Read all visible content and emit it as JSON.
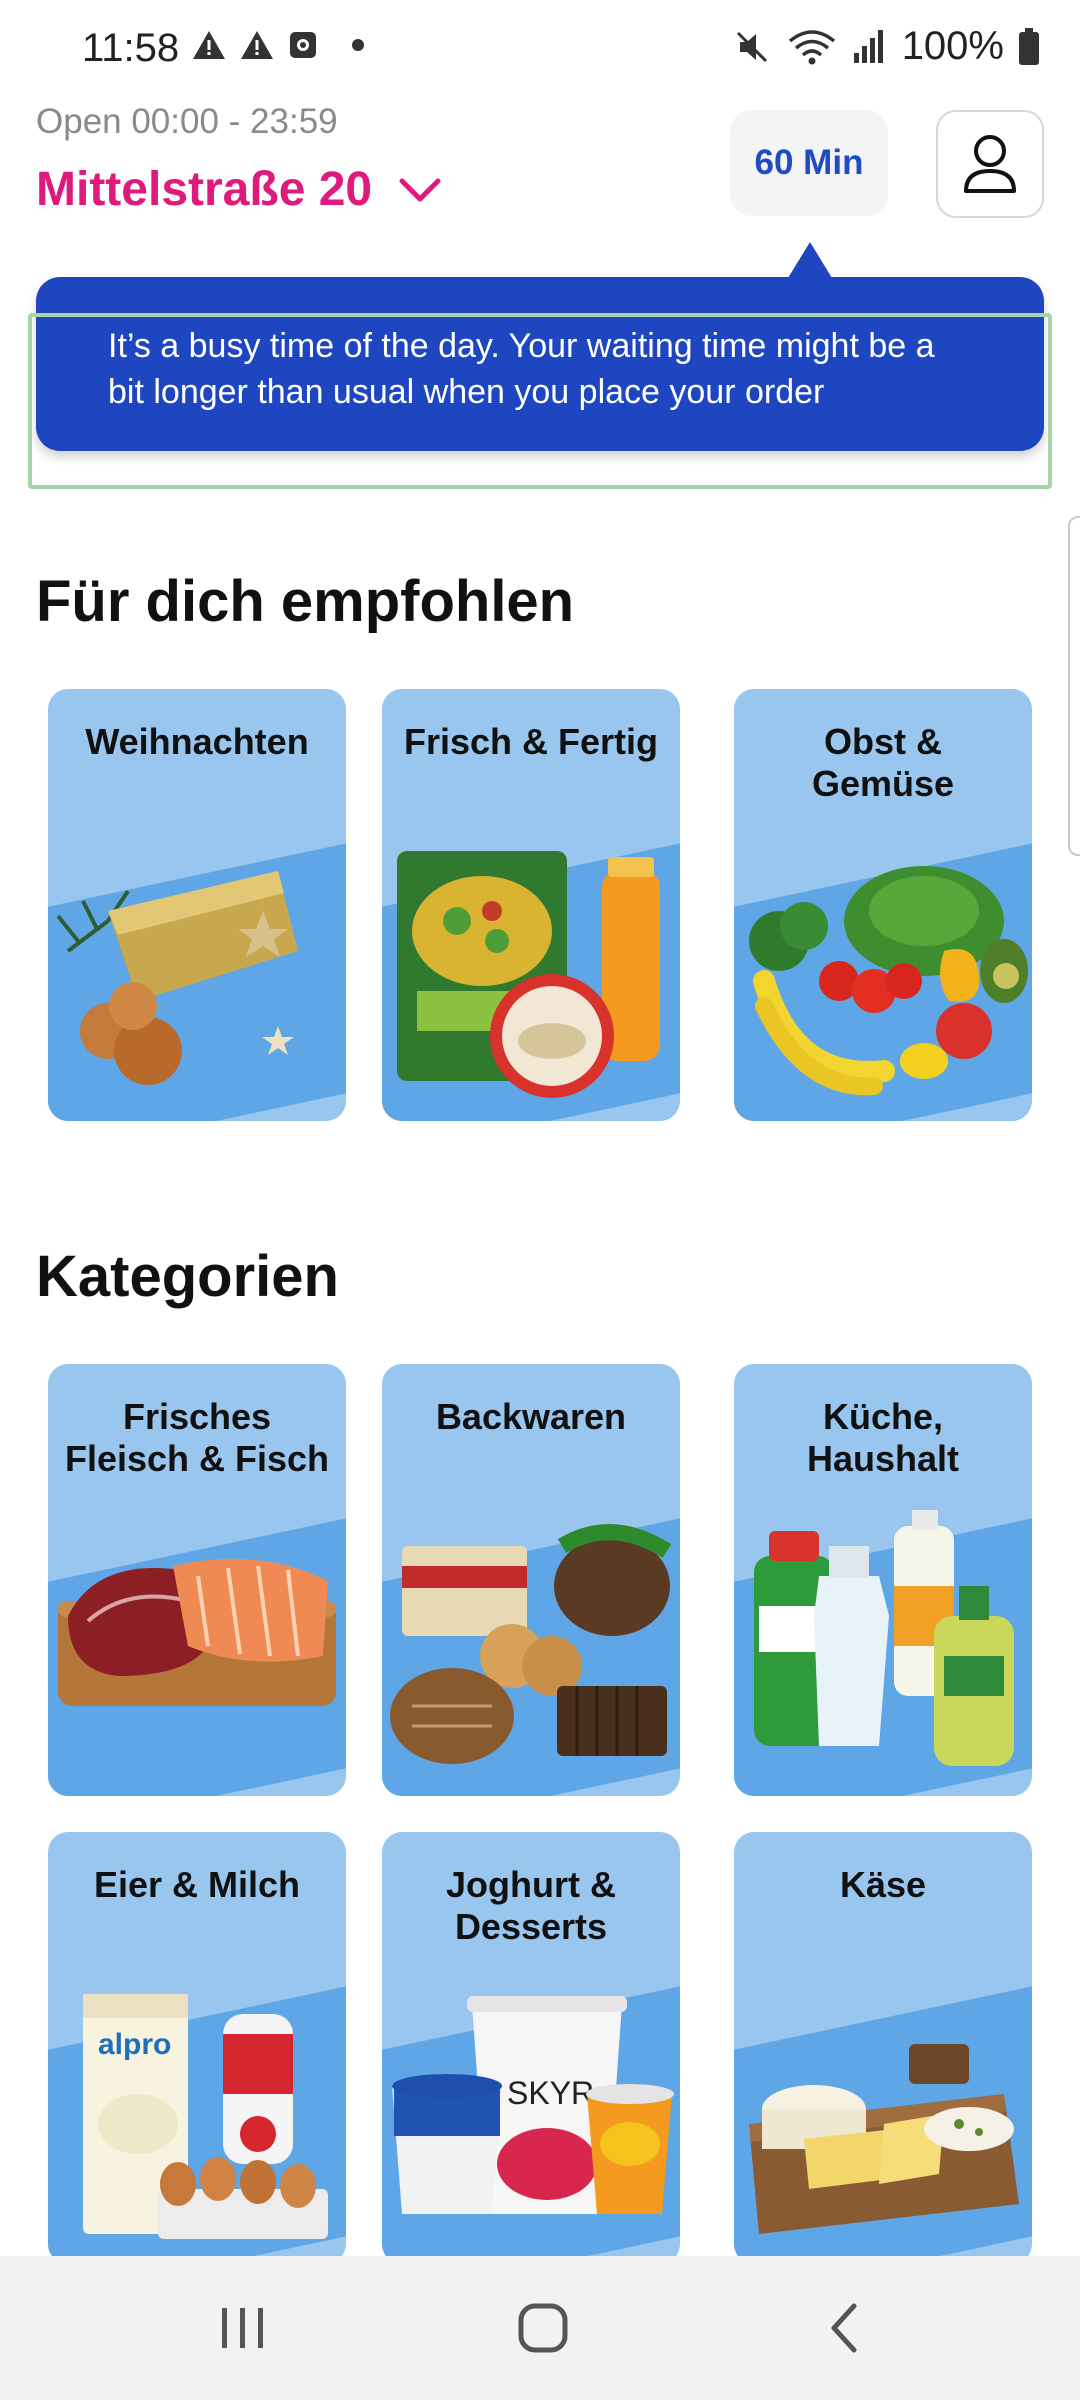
{
  "status_bar": {
    "time": "11:58",
    "battery": "100%",
    "icons": [
      "warning-icon",
      "warning-icon",
      "screen-record-icon",
      "notification-dot-icon",
      "mute-icon",
      "wifi-icon",
      "signal-icon",
      "battery-icon"
    ]
  },
  "header": {
    "open_hours": "Open 00:00 - 23:59",
    "address": "Mittelstraße 20",
    "eta": "60 Min"
  },
  "tooltip": {
    "message": "It’s a busy time of the day. Your waiting time might be a bit longer than usual when you place your order"
  },
  "recommended": {
    "title": "Für dich empfohlen",
    "cards": [
      {
        "label": "Weihnachten",
        "icon": "christmas-gift-icon"
      },
      {
        "label": "Frisch & Fertig",
        "icon": "ready-meal-icon"
      },
      {
        "label": "Obst & Gemüse",
        "icon": "fruit-vegetables-icon"
      }
    ]
  },
  "categories": {
    "title": "Kategorien",
    "cards": [
      {
        "label": "Frisches Fleisch & Fisch",
        "icon": "meat-fish-icon"
      },
      {
        "label": "Backwaren",
        "icon": "bread-icon"
      },
      {
        "label": "Küche, Haushalt",
        "icon": "cleaning-bottles-icon"
      },
      {
        "label": "Eier & Milch",
        "icon": "milk-eggs-icon"
      },
      {
        "label": "Joghurt & Desserts",
        "icon": "yoghurt-icon"
      },
      {
        "label": "Käse",
        "icon": "cheese-board-icon"
      }
    ]
  },
  "colors": {
    "brand_pink": "#e0197d",
    "tooltip_blue": "#1e46c0",
    "card_light": "#98c6ef",
    "card_dark": "#5ea6e6"
  },
  "navigation": [
    "recent-apps-icon",
    "home-icon",
    "back-icon"
  ]
}
